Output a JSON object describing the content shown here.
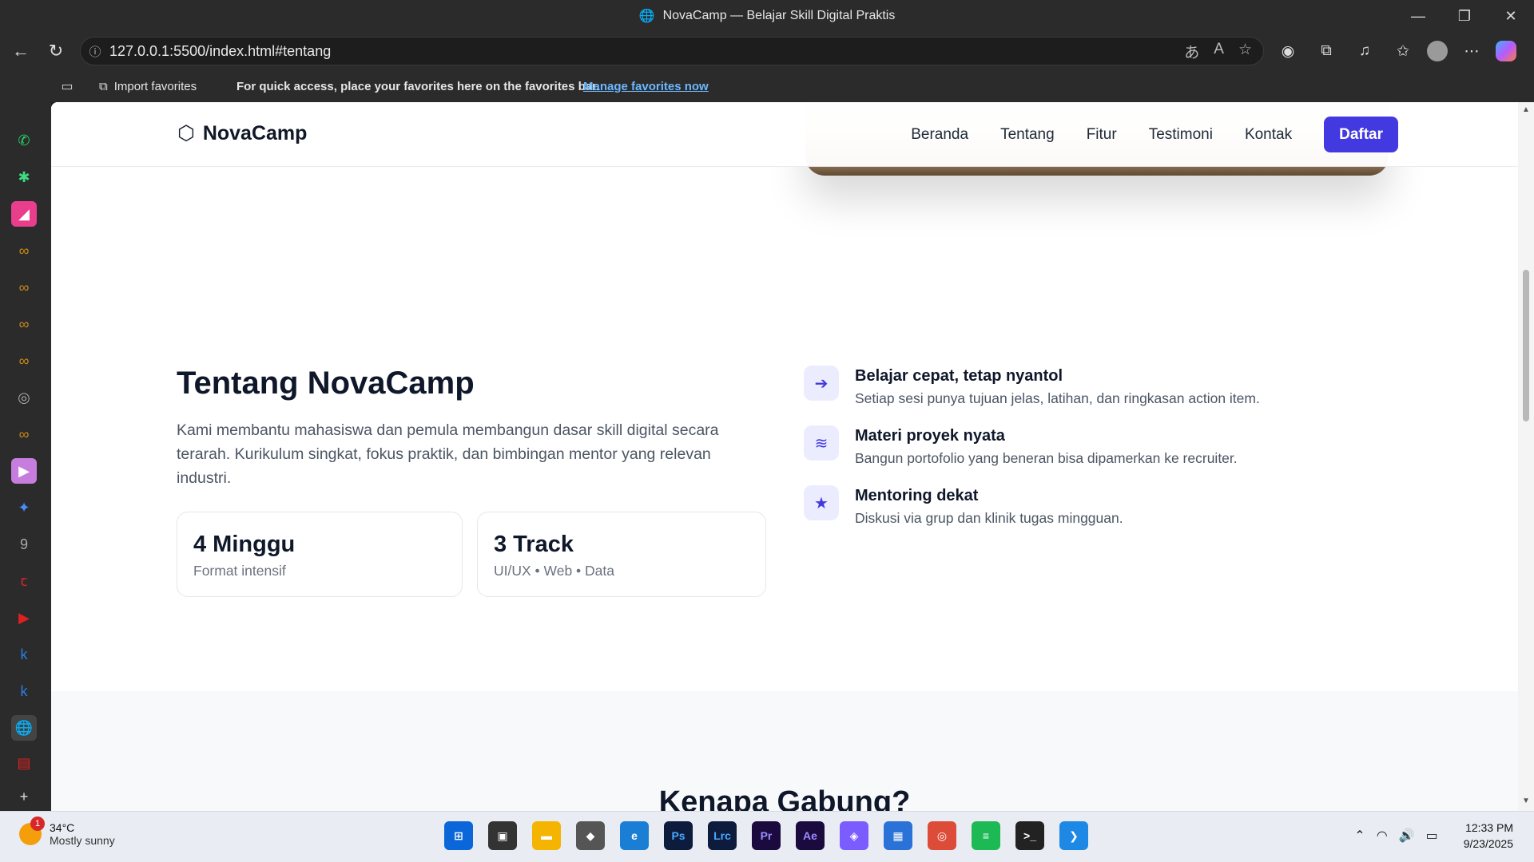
{
  "window": {
    "title": "NovaCamp — Belajar Skill Digital Praktis",
    "controls": [
      "—",
      "❐",
      "✕"
    ]
  },
  "browser": {
    "url": "127.0.0.1:5500/index.html#tentang",
    "favorites": {
      "import_label": "Import favorites",
      "message": "For quick access, place your favorites here on the favorites bar.",
      "manage_link": "Manage favorites now"
    }
  },
  "site": {
    "brand": "NovaCamp",
    "nav": [
      "Beranda",
      "Tentang",
      "Fitur",
      "Testimoni",
      "Kontak"
    ],
    "cta": "Daftar",
    "about": {
      "title": "Tentang NovaCamp",
      "description": "Kami membantu mahasiswa dan pemula membangun dasar skill digital secara terarah. Kurikulum singkat, fokus praktik, dan bimbingan mentor yang relevan industri.",
      "stats": [
        {
          "value": "4 Minggu",
          "label": "Format intensif"
        },
        {
          "value": "3 Track",
          "label": "UI/UX • Web • Data"
        }
      ],
      "features": [
        {
          "icon": "arrow-circle-icon",
          "title": "Belajar cepat, tetap nyantol",
          "desc": "Setiap sesi punya tujuan jelas, latihan, dan ringkasan action item."
        },
        {
          "icon": "layers-icon",
          "title": "Materi proyek nyata",
          "desc": "Bangun portofolio yang beneran bisa dipamerkan ke recruiter."
        },
        {
          "icon": "star-icon",
          "title": "Mentoring dekat",
          "desc": "Diskusi via grup dan klinik tugas mingguan."
        }
      ]
    },
    "why_title": "Kenapa Gabung?"
  },
  "taskbar": {
    "weather": {
      "temp": "34°C",
      "condition": "Mostly sunny",
      "badge": "1"
    },
    "time": "12:33 PM",
    "date": "9/23/2025"
  },
  "colors": {
    "accent": "#4339e0",
    "text": "#0f172a"
  }
}
